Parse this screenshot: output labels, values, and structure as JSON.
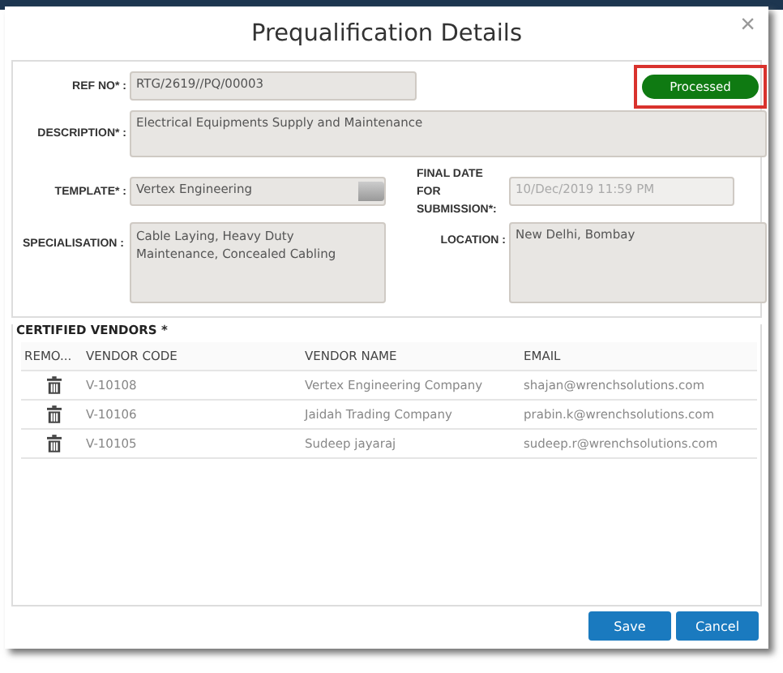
{
  "dialog": {
    "title": "Prequalification Details",
    "close": "×"
  },
  "status": {
    "label": "Processed",
    "highlighted": true
  },
  "fields": [
    {
      "label": "REF NO* :",
      "value": "RTG/2619//PQ/00003",
      "kind": "text",
      "disabled": false
    },
    {
      "label": "DESCRIPTION* :",
      "value": "Electrical  Equipments Supply and Maintenance",
      "kind": "area",
      "disabled": false
    },
    {
      "label": "TEMPLATE* :",
      "value": "Vertex Engineering",
      "kind": "select",
      "disabled": false
    },
    {
      "label": "FINAL DATE FOR SUBMISSION*:",
      "value": "10/Dec/2019 11:59 PM",
      "kind": "text",
      "disabled": true
    },
    {
      "label": "SPECIALISATION :",
      "value": "Cable Laying, Heavy Duty Maintenance, Concealed Cabling",
      "kind": "area",
      "disabled": false
    },
    {
      "label": "LOCATION :",
      "value": "New Delhi, Bombay",
      "kind": "area",
      "disabled": false
    }
  ],
  "certified_vendors": {
    "title": "CERTIFIED VENDORS *",
    "columns": [
      "REMO...",
      "VENDOR CODE",
      "VENDOR NAME",
      "EMAIL"
    ],
    "rows": [
      {
        "code": "V-10108",
        "name": "Vertex Engineering Company",
        "email": "shajan@wrenchsolutions.com"
      },
      {
        "code": "V-10106",
        "name": "Jaidah Trading Company",
        "email": "prabin.k@wrenchsolutions.com"
      },
      {
        "code": "V-10105",
        "name": "Sudeep jayaraj",
        "email": "sudeep.r@wrenchsolutions.com"
      }
    ]
  },
  "buttons": [
    {
      "label": "Save"
    },
    {
      "label": "Cancel"
    }
  ]
}
